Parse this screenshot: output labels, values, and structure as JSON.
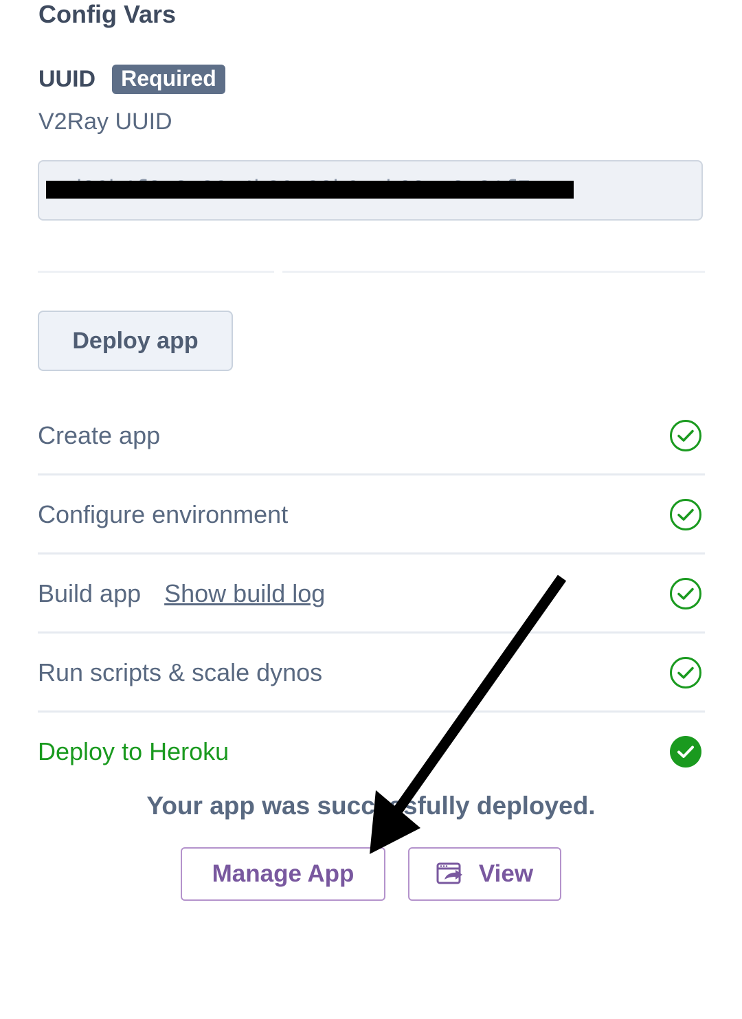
{
  "config": {
    "section_title": "Config Vars",
    "field_label": "UUID",
    "required_badge": "Required",
    "field_description": "V2Ray UUID",
    "field_value": "ad86b4f8-2a26-4b36-93b6-ab98cc8a21f7"
  },
  "deploy_button_label": "Deploy app",
  "steps": [
    {
      "label": "Create app",
      "status": "complete"
    },
    {
      "label": "Configure environment",
      "status": "complete"
    },
    {
      "label": "Build app",
      "link_label": "Show build log",
      "status": "complete"
    },
    {
      "label": "Run scripts & scale dynos",
      "status": "complete"
    },
    {
      "label": "Deploy to Heroku",
      "status": "complete"
    }
  ],
  "result": {
    "message": "Your app was successfully deployed.",
    "manage_button_label": "Manage App",
    "view_button_label": "View"
  },
  "colors": {
    "success_green": "#1a9a1f",
    "accent_purple": "#79589f",
    "text_slate": "#596981",
    "badge_bg": "#5e6f88"
  }
}
